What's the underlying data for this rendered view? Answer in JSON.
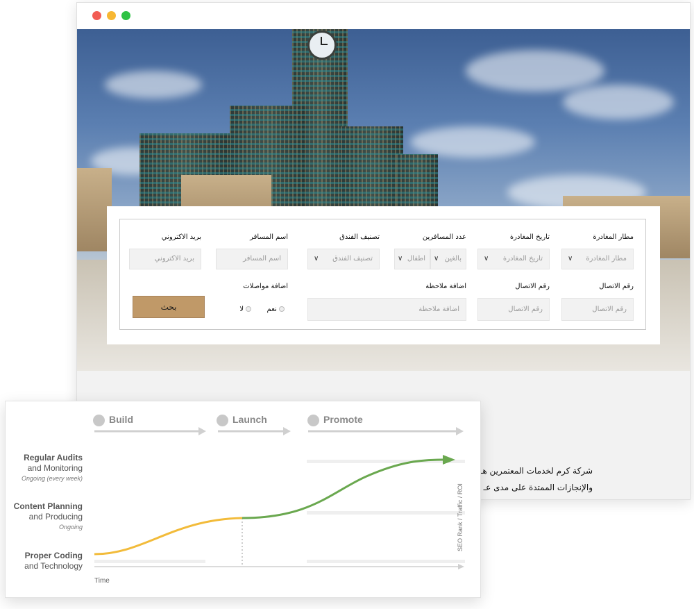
{
  "browser": {
    "buttons": [
      "close",
      "minimize",
      "maximize"
    ]
  },
  "booking_form": {
    "row1": [
      {
        "label": "مطار المغادرة",
        "placeholder": "مطار المغادرة",
        "dropdown": true
      },
      {
        "label": "تاريخ المغادرة",
        "placeholder": "تاريخ المغادرة",
        "dropdown": true
      },
      {
        "label": "عدد المسافرين",
        "adults": "بالغين",
        "children": "اطفال"
      },
      {
        "label": "تصنيف الفندق",
        "placeholder": "تصنيف الفندق",
        "dropdown": true
      },
      {
        "label": "اسم المسافر",
        "placeholder": "اسم المسافر"
      },
      {
        "label": "بريد الاكتروني",
        "placeholder": "بريد الاكتروني"
      }
    ],
    "row2": {
      "phone1": {
        "label": "رقم الاتصال",
        "placeholder": "رقم الاتصال"
      },
      "phone2": {
        "label": "رقم الاتصال",
        "placeholder": "رقم الاتصال"
      },
      "note": {
        "label": "اضافة ملاحظة",
        "placeholder": "اضافة ملاحظة"
      },
      "transport": {
        "label": "اضافة مواصلات",
        "yes": "نعم",
        "no": "لا"
      },
      "search_button": "بحث"
    }
  },
  "description": {
    "line1": "شركة كرم لخدمات المعتمرين هـ",
    "line2": "والإنجازات الممتدة على مدى عـ"
  },
  "roadmap": {
    "phases": [
      {
        "label": "Build",
        "icon": "compass-icon"
      },
      {
        "label": "Launch",
        "icon": "mountain-icon"
      },
      {
        "label": "Promote",
        "icon": "refresh-icon"
      }
    ],
    "rows": [
      {
        "title": "Regular Audits",
        "subtitle": "and Monitoring",
        "note": "Ongoing (every week)"
      },
      {
        "title": "Content Planning",
        "subtitle": "and Producing",
        "note": "Ongoing"
      },
      {
        "title": "Proper Coding",
        "subtitle": "and Technology",
        "note": ""
      }
    ],
    "x_axis_label": "Time",
    "y_axis_label": "SEO Rank / Traffic / ROI",
    "colors": {
      "build_curve": "#f2bb3a",
      "growth_curve": "#6aa84f",
      "arrows": "#cfcfcf"
    }
  }
}
